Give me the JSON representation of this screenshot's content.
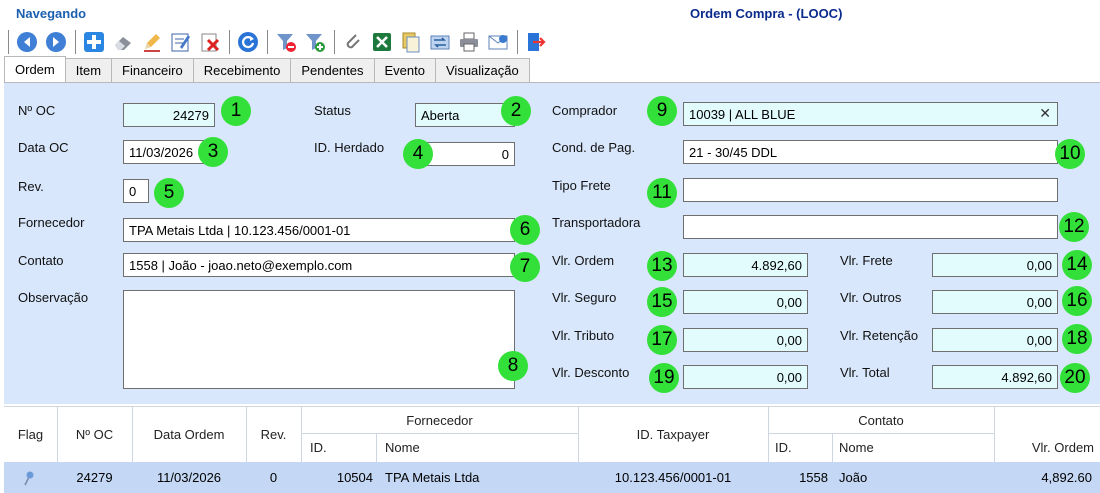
{
  "header": {
    "status_text": "Navegando",
    "window_title": "Ordem Compra - (LOOC)"
  },
  "toolbar": {
    "buttons": [
      {
        "icon": "arrow-left-icon"
      },
      {
        "icon": "arrow-right-icon"
      },
      {
        "icon": "add-icon"
      },
      {
        "icon": "eraser-icon"
      },
      {
        "icon": "edit-pencil-icon"
      },
      {
        "icon": "edit-form-icon"
      },
      {
        "icon": "delete-icon"
      },
      {
        "icon": "refresh-icon"
      },
      {
        "icon": "filter-remove-icon"
      },
      {
        "icon": "filter-add-icon"
      },
      {
        "icon": "attach-icon"
      },
      {
        "icon": "excel-icon"
      },
      {
        "icon": "copy-icon"
      },
      {
        "icon": "transfer-icon"
      },
      {
        "icon": "print-icon"
      },
      {
        "icon": "email-icon"
      },
      {
        "icon": "exit-icon"
      }
    ]
  },
  "tabs": [
    {
      "label": "Ordem",
      "active": true
    },
    {
      "label": "Item"
    },
    {
      "label": "Financeiro"
    },
    {
      "label": "Recebimento"
    },
    {
      "label": "Pendentes"
    },
    {
      "label": "Evento"
    },
    {
      "label": "Visualização"
    }
  ],
  "form": {
    "num_oc": {
      "label": "Nº OC",
      "value": "24279",
      "badge": "1"
    },
    "status": {
      "label": "Status",
      "value": "Aberta",
      "badge": "2"
    },
    "data_oc": {
      "label": "Data OC",
      "value": "11/03/2026",
      "badge": "3"
    },
    "id_herdado": {
      "label": "ID. Herdado",
      "value": "0",
      "badge": "4"
    },
    "rev": {
      "label": "Rev.",
      "value": "0",
      "badge": "5"
    },
    "fornecedor": {
      "label": "Fornecedor",
      "value": "TPA Metais Ltda | 10.123.456/0001-01",
      "badge": "6"
    },
    "contato": {
      "label": "Contato",
      "value": "1558 | João - joao.neto@exemplo.com",
      "badge": "7"
    },
    "observacao": {
      "label": "Observação",
      "value": "",
      "badge": "8"
    },
    "comprador": {
      "label": "Comprador",
      "value": "10039 | ALL BLUE",
      "badge": "9"
    },
    "cond_pag": {
      "label": "Cond. de Pag.",
      "value": "21 - 30/45 DDL",
      "badge": "10"
    },
    "tipo_frete": {
      "label": "Tipo Frete",
      "value": "",
      "badge": "11"
    },
    "transportadora": {
      "label": "Transportadora",
      "value": "",
      "badge": "12"
    },
    "vlr_ordem": {
      "label": "Vlr. Ordem",
      "value": "4.892,60",
      "badge": "13"
    },
    "vlr_frete": {
      "label": "Vlr. Frete",
      "value": "0,00",
      "badge": "14"
    },
    "vlr_seguro": {
      "label": "Vlr. Seguro",
      "value": "0,00",
      "badge": "15"
    },
    "vlr_outros": {
      "label": "Vlr. Outros",
      "value": "0,00",
      "badge": "16"
    },
    "vlr_tributo": {
      "label": "Vlr. Tributo",
      "value": "0,00",
      "badge": "17"
    },
    "vlr_retencao": {
      "label": "Vlr. Retenção",
      "value": "0,00",
      "badge": "18"
    },
    "vlr_desconto": {
      "label": "Vlr. Desconto",
      "value": "0,00",
      "badge": "19"
    },
    "vlr_total": {
      "label": "Vlr. Total",
      "value": "4.892,60",
      "badge": "20"
    },
    "clear_symbol": "✕"
  },
  "grid": {
    "headers": {
      "flag": "Flag",
      "num_oc": "Nº OC",
      "data_ordem": "Data Ordem",
      "rev": "Rev.",
      "fornecedor": "Fornecedor",
      "fornecedor_id": "ID.",
      "fornecedor_nome": "Nome",
      "id_taxpayer": "ID. Taxpayer",
      "contato": "Contato",
      "contato_id": "ID.",
      "contato_nome": "Nome",
      "vlr_ordem": "Vlr. Ordem"
    },
    "rows": [
      {
        "num_oc": "24279",
        "data_ordem": "11/03/2026",
        "rev": "0",
        "fornecedor_id": "10504",
        "fornecedor_nome": "TPA Metais Ltda",
        "id_taxpayer": "10.123.456/0001-01",
        "contato_id": "1558",
        "contato_nome": "João",
        "vlr_ordem": "4,892.60",
        "flag_icon": "pin-icon"
      }
    ]
  }
}
